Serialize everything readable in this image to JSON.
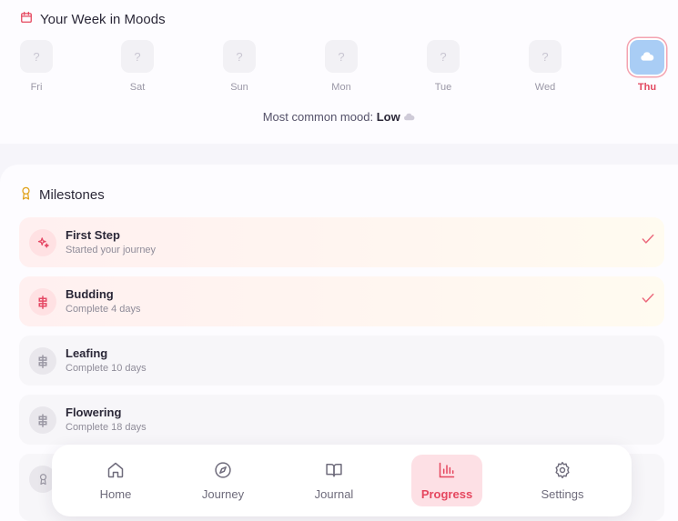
{
  "week": {
    "title": "Your Week in Moods",
    "days": [
      {
        "label": "Fri",
        "mood": "?"
      },
      {
        "label": "Sat",
        "mood": "?"
      },
      {
        "label": "Sun",
        "mood": "?"
      },
      {
        "label": "Mon",
        "mood": "?"
      },
      {
        "label": "Tue",
        "mood": "?"
      },
      {
        "label": "Wed",
        "mood": "?"
      },
      {
        "label": "Thu",
        "mood": "cloud-icon"
      }
    ],
    "common_mood_label": "Most common mood:",
    "common_mood_value": "Low"
  },
  "milestones": {
    "title": "Milestones",
    "items": [
      {
        "name": "First Step",
        "desc": "Started your journey",
        "icon": "sparkle-icon",
        "completed": true
      },
      {
        "name": "Budding",
        "desc": "Complete 4 days",
        "icon": "sprout-icon",
        "completed": true
      },
      {
        "name": "Leafing",
        "desc": "Complete 10 days",
        "icon": "sprout-icon",
        "completed": false
      },
      {
        "name": "Flowering",
        "desc": "Complete 18 days",
        "icon": "sprout-icon",
        "completed": false
      }
    ]
  },
  "nav": {
    "items": [
      {
        "label": "Home",
        "icon": "home-icon"
      },
      {
        "label": "Journey",
        "icon": "compass-icon"
      },
      {
        "label": "Journal",
        "icon": "book-icon"
      },
      {
        "label": "Progress",
        "icon": "chart-icon",
        "active": true
      },
      {
        "label": "Settings",
        "icon": "gear-icon"
      }
    ]
  },
  "colors": {
    "accent": "#e5475f",
    "today_mood": "#a9cdf5"
  }
}
